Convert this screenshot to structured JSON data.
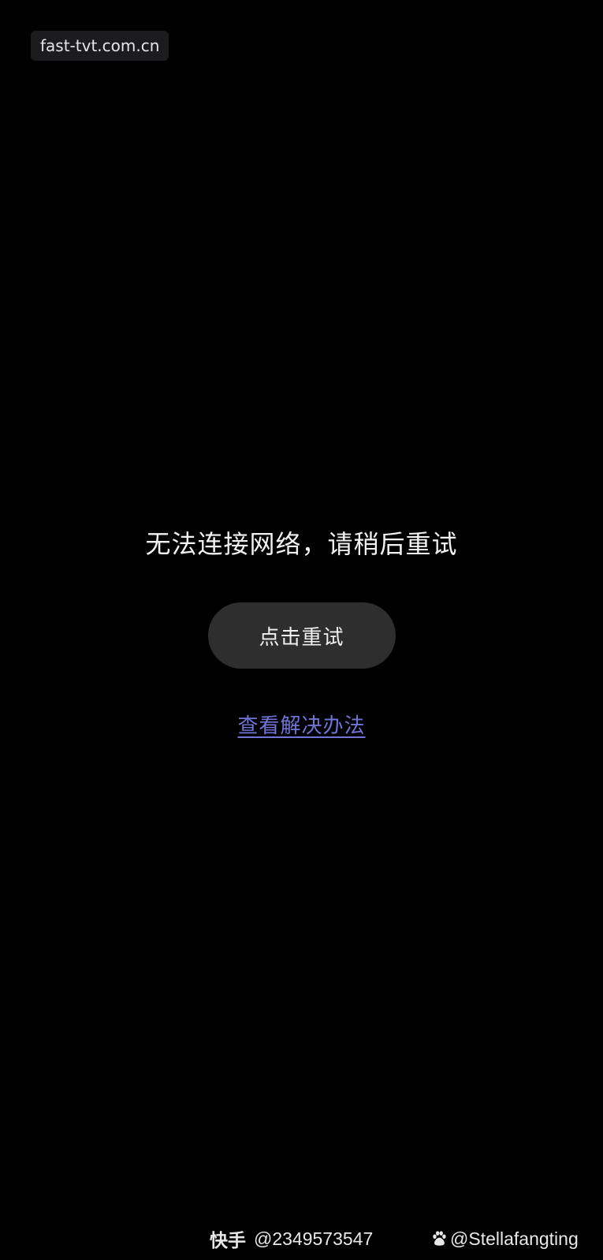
{
  "url_bar": {
    "host": "fast-tvt.com.cn"
  },
  "error": {
    "message": "无法连接网络，请稍后重试",
    "retry_label": "点击重试",
    "help_link": "查看解决办法"
  },
  "watermarks": {
    "kuaishou_brand": "快手",
    "kuaishou_id": "@2349573547",
    "baidu_icon": "paw-icon",
    "baidu_user": "@Stellafangting"
  },
  "colors": {
    "background": "#000000",
    "button_bg": "#2e2e2e",
    "link": "#6f74d6"
  }
}
